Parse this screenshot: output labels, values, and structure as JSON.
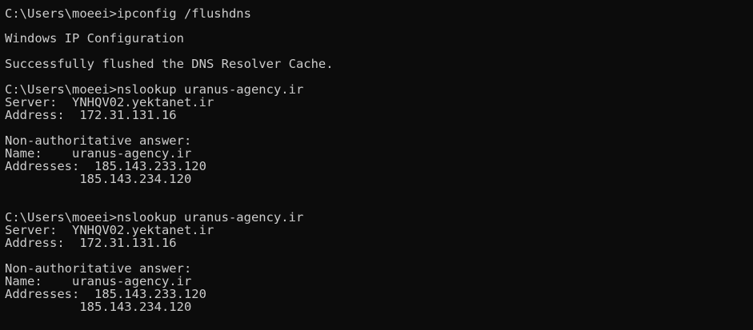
{
  "terminal": {
    "lines": [
      "C:\\Users\\moeei>ipconfig /flushdns",
      "Windows IP Configuration",
      "Successfully flushed the DNS Resolver Cache.",
      "C:\\Users\\moeei>nslookup uranus-agency.ir",
      "Server:  YNHQV02.yektanet.ir",
      "Address:  172.31.131.16",
      "Non-authoritative answer:",
      "Name:    uranus-agency.ir",
      "Addresses:  185.143.233.120",
      "          185.143.234.120",
      "C:\\Users\\moeei>nslookup uranus-agency.ir",
      "Server:  YNHQV02.yektanet.ir",
      "Address:  172.31.131.16",
      "Non-authoritative answer:",
      "Name:    uranus-agency.ir",
      "Addresses:  185.143.233.120",
      "          185.143.234.120"
    ]
  },
  "colors": {
    "background": "#0c0c0c",
    "text": "#cccccc"
  }
}
